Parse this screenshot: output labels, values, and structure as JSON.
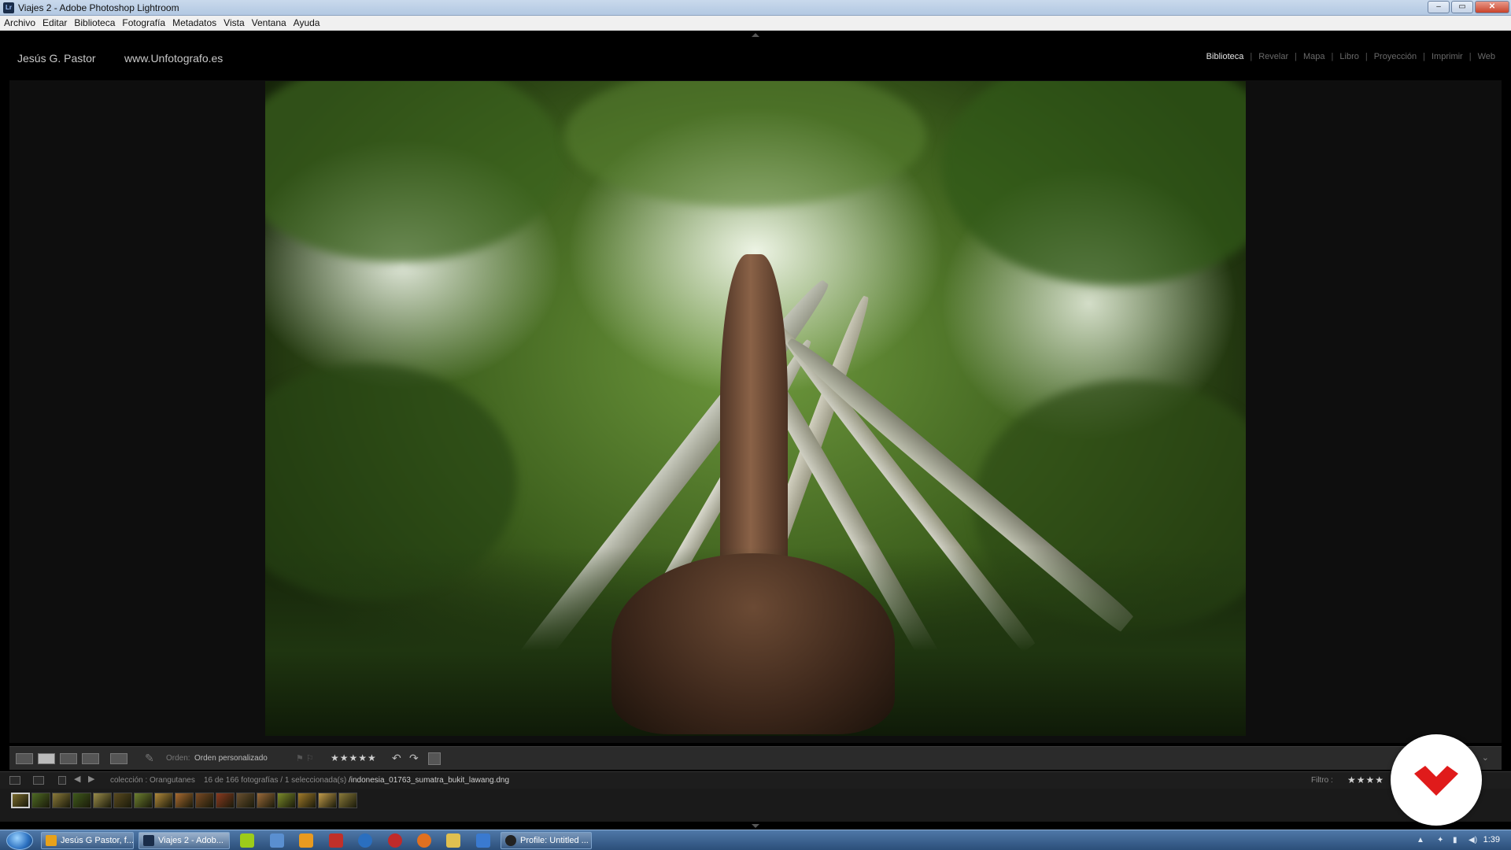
{
  "window": {
    "title": "Viajes 2 - Adobe Photoshop Lightroom",
    "app_icon": "Lr",
    "buttons": {
      "minimize": "–",
      "restore": "▭",
      "close": "✕"
    }
  },
  "menubar": {
    "items": [
      "Archivo",
      "Editar",
      "Biblioteca",
      "Fotografía",
      "Metadatos",
      "Vista",
      "Ventana",
      "Ayuda"
    ]
  },
  "identity_plate": {
    "name": "Jesús G. Pastor",
    "website": "www.Unfotografo.es"
  },
  "modules": {
    "items": [
      {
        "label": "Biblioteca",
        "active": true
      },
      {
        "label": "Revelar",
        "active": false
      },
      {
        "label": "Mapa",
        "active": false
      },
      {
        "label": "Libro",
        "active": false
      },
      {
        "label": "Proyección",
        "active": false
      },
      {
        "label": "Imprimir",
        "active": false
      },
      {
        "label": "Web",
        "active": false
      }
    ],
    "separator": "|"
  },
  "toolbar": {
    "order_label": "Orden:",
    "order_value": "Orden personalizado",
    "rating_stars": "★★★★★",
    "rotate_left": "↶",
    "rotate_right": "↷",
    "flags": "⚑ ⚐",
    "more": "⌄"
  },
  "filmstrip_header": {
    "path_source": "colección : Orangutanes",
    "path_count": "16 de 166 fotografías / 1 seleccionada(s)",
    "path_file": "/indonesia_01763_sumatra_bukit_lawang.dng",
    "filter_label": "Filtro :",
    "filter_stars": "★★★★"
  },
  "filmstrip": {
    "thumb_colors": [
      "#7a6b2e",
      "#4e6b24",
      "#8b7a3a",
      "#3f5a1c",
      "#9a8c4a",
      "#5a4a20",
      "#6d8030",
      "#b0883a",
      "#a86a30",
      "#7a4a24",
      "#8a3a20",
      "#6a5030",
      "#9a6a3a",
      "#7a8a2a",
      "#a07a2a",
      "#c09a4a",
      "#8a7a3a"
    ],
    "selected_index": 0
  },
  "taskbar": {
    "tasks": [
      {
        "label": "Jesús G Pastor, f...",
        "icon_color": "#e8a21a"
      },
      {
        "label": "Viajes 2 - Adob...",
        "icon_color": "#1a2d4a"
      },
      {
        "label": "Profile: Untitled ...",
        "icon_color": "#222222"
      }
    ],
    "quicklaunch_colors": [
      "#9ccc1a",
      "#5a8fd0",
      "#e89a20",
      "#c0302a",
      "#2a6fc0",
      "#c02a2a",
      "#e07020",
      "#e0c050",
      "#3a7ad0"
    ],
    "clock": "1:39"
  },
  "colors": {
    "lr_background": "#000000",
    "module_active": "#e6e6e6",
    "badge_red": "#e01b1b"
  },
  "icons": [
    "lightroom-icon",
    "grid-view-icon",
    "loupe-view-icon",
    "compare-view-icon",
    "survey-view-icon",
    "people-view-icon",
    "painter-icon",
    "rotate-left-icon",
    "rotate-right-icon",
    "crop-icon",
    "start-orb-icon",
    "watermark-logo-icon"
  ]
}
